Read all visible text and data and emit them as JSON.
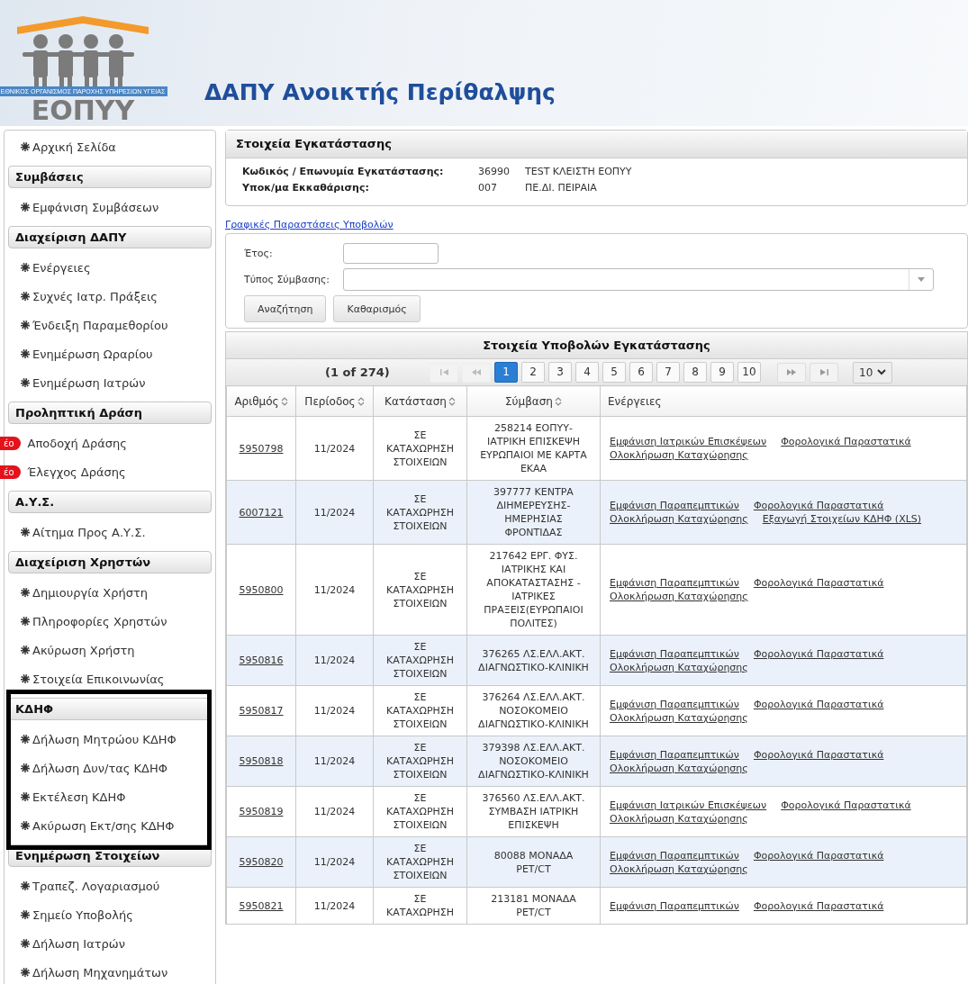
{
  "logo": {
    "tagline": "ΕΘΝΙΚΟΣ ΟΡΓΑΝΙΣΜΟΣ ΠΑΡΟΧΗΣ ΥΠΗΡΕΣΙΩΝ ΥΓΕΙΑΣ",
    "name": "ΕΟΠΥΥ"
  },
  "page_title": "ΔΑΠΥ Ανοικτής Περίθαλψης",
  "sidebar": [
    {
      "kind": "link",
      "label": "Αρχική Σελίδα"
    },
    {
      "kind": "heading",
      "label": "Συμβάσεις"
    },
    {
      "kind": "link",
      "label": "Εμφάνιση Συμβάσεων"
    },
    {
      "kind": "heading",
      "label": "Διαχείριση ΔΑΠΥ"
    },
    {
      "kind": "link",
      "label": "Ενέργειες"
    },
    {
      "kind": "link",
      "label": "Συχνές Ιατρ. Πράξεις"
    },
    {
      "kind": "link",
      "label": "Ένδειξη Παραμεθορίου"
    },
    {
      "kind": "link",
      "label": "Ενημέρωση Ωραρίου"
    },
    {
      "kind": "link",
      "label": "Ενημέρωση Ιατρών"
    },
    {
      "kind": "heading",
      "label": "Προληπτική Δράση"
    },
    {
      "kind": "new",
      "badge": "έο",
      "label": "Αποδοχή Δράσης"
    },
    {
      "kind": "new",
      "badge": "έο",
      "label": "Έλεγχος Δράσης"
    },
    {
      "kind": "heading",
      "label": "Α.Υ.Σ."
    },
    {
      "kind": "link",
      "label": "Αίτημα Προς Α.Υ.Σ."
    },
    {
      "kind": "heading",
      "label": "Διαχείριση Χρηστών"
    },
    {
      "kind": "link",
      "label": "Δημιουργία Χρήστη"
    },
    {
      "kind": "link",
      "label": "Πληροφορίες Χρηστών"
    },
    {
      "kind": "link",
      "label": "Ακύρωση Χρήστη"
    },
    {
      "kind": "link",
      "label": "Στοιχεία Επικοινωνίας"
    },
    {
      "kind": "heading",
      "label": "ΚΔΗΦ"
    },
    {
      "kind": "link",
      "label": "Δήλωση Μητρώου ΚΔΗΦ"
    },
    {
      "kind": "link",
      "label": "Δήλωση Δυν/τας ΚΔΗΦ"
    },
    {
      "kind": "link",
      "label": "Εκτέλεση ΚΔΗΦ"
    },
    {
      "kind": "link",
      "label": "Ακύρωση Εκτ/σης ΚΔΗΦ"
    },
    {
      "kind": "heading",
      "label": "Ενημέρωση Στοιχείων"
    },
    {
      "kind": "link",
      "label": "Τραπεζ. Λογαριασμού"
    },
    {
      "kind": "link",
      "label": "Σημείο Υποβολής"
    },
    {
      "kind": "link",
      "label": "Δήλωση Ιατρών"
    },
    {
      "kind": "link",
      "label": "Δήλωση Μηχανημάτων"
    }
  ],
  "facility": {
    "title": "Στοιχεία Εγκατάστασης",
    "rows": [
      {
        "label": "Κωδικός / Επωνυμία Εγκατάστασης:",
        "code": "36990",
        "value": "TEST ΚΛΕΙΣΤΗ ΕΟΠΥΥ"
      },
      {
        "label": "Υποκ/μα Εκκαθάρισης:",
        "code": "007",
        "value": "ΠΕ.ΔΙ. ΠΕΙΡΑΙΑ"
      }
    ]
  },
  "charts_link": "Γραφικές Παραστάσεις Υποβολών",
  "search": {
    "year_label": "Έτος:",
    "type_label": "Τύπος Σύμβασης:",
    "buttons": [
      "Αναζήτηση",
      "Καθαρισμός"
    ]
  },
  "submissions": {
    "title": "Στοιχεία Υποβολών Εγκατάστασης",
    "page_info": "(1 of 274)",
    "pages": [
      {
        "label": "1",
        "selected": true
      },
      {
        "label": "2",
        "selected": false
      },
      {
        "label": "3",
        "selected": false
      },
      {
        "label": "4",
        "selected": false
      },
      {
        "label": "5",
        "selected": false
      },
      {
        "label": "6",
        "selected": false
      },
      {
        "label": "7",
        "selected": false
      },
      {
        "label": "8",
        "selected": false
      },
      {
        "label": "9",
        "selected": false
      },
      {
        "label": "10",
        "selected": false
      }
    ],
    "rows_per_page": "10",
    "columns": [
      {
        "label": "Αριθμός",
        "sortable": true
      },
      {
        "label": "Περίοδος",
        "sortable": true
      },
      {
        "label": "Κατάσταση",
        "sortable": true
      },
      {
        "label": "Σύμβαση",
        "sortable": true
      },
      {
        "label": "Ενέργειες",
        "sortable": false
      }
    ],
    "rows": [
      {
        "number": "5950798",
        "period": "11/2024",
        "status": "ΣΕ ΚΑΤΑΧΩΡΗΣΗ ΣΤΟΙΧΕΙΩΝ",
        "contract": "258214 ΕΟΠΥΥ-ΙΑΤΡΙΚΗ ΕΠΙΣΚΕΨΗ ΕΥΡΩΠΑΙΟΙ ΜΕ ΚΑΡΤΑ ΕΚΑΑ",
        "actions": [
          [
            "Εμφάνιση Ιατρικών Επισκέψεων",
            "Φορολογικά Παραστατικά"
          ],
          [
            "Ολοκλήρωση Καταχώρησης"
          ]
        ]
      },
      {
        "number": "6007121",
        "period": "11/2024",
        "status": "ΣΕ ΚΑΤΑΧΩΡΗΣΗ ΣΤΟΙΧΕΙΩΝ",
        "contract": "397777 ΚΕΝΤΡΑ ΔΙΗΜΕΡΕΥΣΗΣ-ΗΜΕΡΗΣΙΑΣ ΦΡΟΝΤΙΔΑΣ",
        "actions": [
          [
            "Εμφάνιση Παραπεμπτικών",
            "Φορολογικά Παραστατικά"
          ],
          [
            "Ολοκλήρωση Καταχώρησης",
            "Εξαγωγή Στοιχείων ΚΔΗΦ (XLS)"
          ]
        ]
      },
      {
        "number": "5950800",
        "period": "11/2024",
        "status": "ΣΕ ΚΑΤΑΧΩΡΗΣΗ ΣΤΟΙΧΕΙΩΝ",
        "contract": "217642 ΕΡΓ. ΦΥΣ. ΙΑΤΡΙΚΗΣ ΚΑΙ ΑΠΟΚΑΤΑΣΤΑΣΗΣ - ΙΑΤΡΙΚΕΣ ΠΡΑΞΕΙΣ(ΕΥΡΩΠΑΙΟΙ ΠΟΛΙΤΕΣ)",
        "actions": [
          [
            "Εμφάνιση Παραπεμπτικών",
            "Φορολογικά Παραστατικά"
          ],
          [
            "Ολοκλήρωση Καταχώρησης"
          ]
        ]
      },
      {
        "number": "5950816",
        "period": "11/2024",
        "status": "ΣΕ ΚΑΤΑΧΩΡΗΣΗ ΣΤΟΙΧΕΙΩΝ",
        "contract": "376265 ΛΣ.ΕΛΛ.ΑΚΤ. ΔΙΑΓΝΩΣΤΙΚΟ-ΚΛΙΝΙΚΗ",
        "actions": [
          [
            "Εμφάνιση Παραπεμπτικών",
            "Φορολογικά Παραστατικά"
          ],
          [
            "Ολοκλήρωση Καταχώρησης"
          ]
        ]
      },
      {
        "number": "5950817",
        "period": "11/2024",
        "status": "ΣΕ ΚΑΤΑΧΩΡΗΣΗ ΣΤΟΙΧΕΙΩΝ",
        "contract": "376264 ΛΣ.ΕΛΛ.ΑΚΤ. ΝΟΣΟΚΟΜΕΙΟ ΔΙΑΓΝΩΣΤΙΚΟ-ΚΛΙΝΙΚΗ",
        "actions": [
          [
            "Εμφάνιση Παραπεμπτικών",
            "Φορολογικά Παραστατικά"
          ],
          [
            "Ολοκλήρωση Καταχώρησης"
          ]
        ]
      },
      {
        "number": "5950818",
        "period": "11/2024",
        "status": "ΣΕ ΚΑΤΑΧΩΡΗΣΗ ΣΤΟΙΧΕΙΩΝ",
        "contract": "379398 ΛΣ.ΕΛΛ.ΑΚΤ. ΝΟΣΟΚΟΜΕΙΟ ΔΙΑΓΝΩΣΤΙΚΟ-ΚΛΙΝΙΚΗ",
        "actions": [
          [
            "Εμφάνιση Παραπεμπτικών",
            "Φορολογικά Παραστατικά"
          ],
          [
            "Ολοκλήρωση Καταχώρησης"
          ]
        ]
      },
      {
        "number": "5950819",
        "period": "11/2024",
        "status": "ΣΕ ΚΑΤΑΧΩΡΗΣΗ ΣΤΟΙΧΕΙΩΝ",
        "contract": "376560 ΛΣ.ΕΛΛ.ΑΚΤ. ΣΥΜΒΑΣΗ ΙΑΤΡΙΚΗ ΕΠΙΣΚΕΨΗ",
        "actions": [
          [
            "Εμφάνιση Ιατρικών Επισκέψεων",
            "Φορολογικά Παραστατικά"
          ],
          [
            "Ολοκλήρωση Καταχώρησης"
          ]
        ]
      },
      {
        "number": "5950820",
        "period": "11/2024",
        "status": "ΣΕ ΚΑΤΑΧΩΡΗΣΗ ΣΤΟΙΧΕΙΩΝ",
        "contract": "80088 ΜΟΝΑΔΑ PET/CT",
        "actions": [
          [
            "Εμφάνιση Παραπεμπτικών",
            "Φορολογικά Παραστατικά"
          ],
          [
            "Ολοκλήρωση Καταχώρησης"
          ]
        ]
      },
      {
        "number": "5950821",
        "period": "11/2024",
        "status": "ΣΕ ΚΑΤΑΧΩΡΗΣΗ",
        "contract": "213181 ΜΟΝΑΔΑ PET/CT",
        "actions": [
          [
            "Εμφάνιση Παραπεμπτικών",
            "Φορολογικά Παραστατικά"
          ]
        ]
      }
    ]
  }
}
